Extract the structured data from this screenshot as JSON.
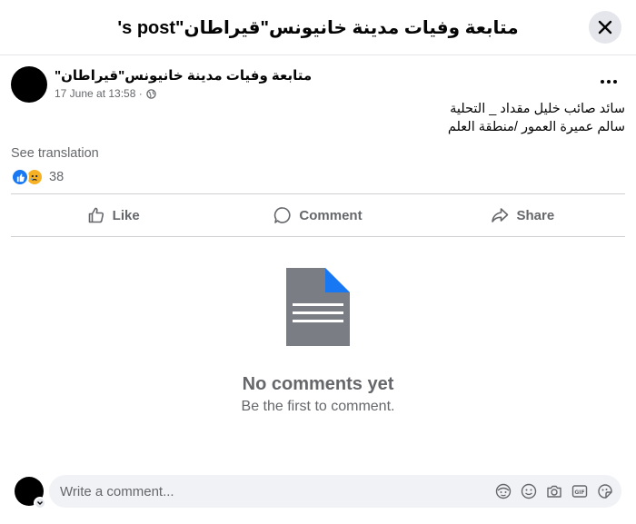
{
  "header": {
    "title": "'s post\"متابعة وفيات مدينة خانيونس\"قيراطان",
    "close_icon": "close-icon"
  },
  "post": {
    "author": "\"متابعة وفيات مدينة خانيونس\"قيراطان",
    "timestamp": "17 June at 13:58 ·",
    "audience_icon": "globe-icon",
    "body_line1": "سائد صائب خليل مقداد _ التحلية",
    "body_line2": "سالم عميرة العمور /منطقة العلم",
    "see_translation": "See translation",
    "reaction_count": "38",
    "reaction_icons": [
      "like-icon",
      "sad-icon"
    ]
  },
  "actions": {
    "like": "Like",
    "comment": "Comment",
    "share": "Share"
  },
  "empty_state": {
    "title": "No comments yet",
    "subtitle": "Be the first to comment.",
    "icon": "document-icon"
  },
  "composer": {
    "placeholder": "Write a comment...",
    "icons": [
      "avatar-sticker-icon",
      "emoji-icon",
      "camera-icon",
      "gif-icon",
      "sticker-icon"
    ]
  },
  "colors": {
    "like_blue": "#1877f2",
    "sad_yellow": "#f7b125",
    "secondary_text": "#65676b",
    "doc_grey": "#7a7d83",
    "doc_corner_blue": "#1877f2"
  }
}
